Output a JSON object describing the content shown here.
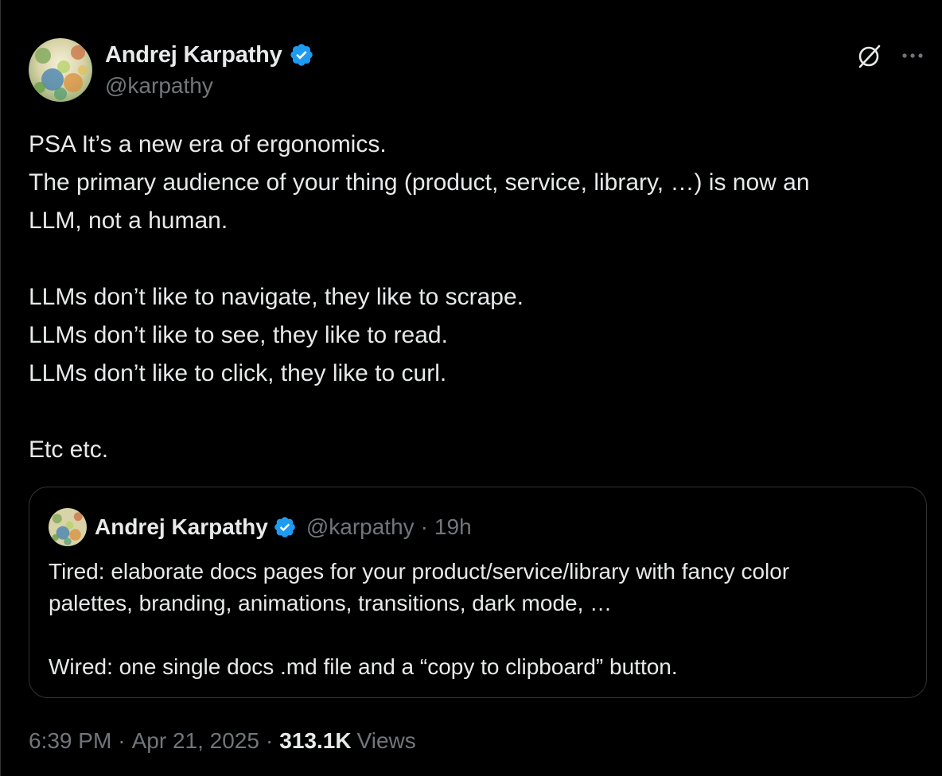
{
  "author": {
    "display_name": "Andrej Karpathy",
    "handle": "@karpathy",
    "verified": true,
    "verified_color": "#1d9bf0"
  },
  "header_actions": {
    "grok_icon": "grok-icon",
    "more_icon": "more-dots-icon"
  },
  "tweet": {
    "lines": [
      "PSA It’s a new era of ergonomics.",
      "The primary audience of your thing (product, service, library, …) is now an",
      "LLM, not a human.",
      "",
      "LLMs don’t like to navigate, they like to scrape.",
      "LLMs don’t like to see, they like to read.",
      "LLMs don’t like to click, they like to curl.",
      "",
      "Etc etc."
    ]
  },
  "quote": {
    "display_name": "Andrej Karpathy",
    "handle": "@karpathy",
    "separator": "·",
    "time": "19h",
    "lines": [
      "Tired: elaborate docs pages for your product/service/library with fancy color",
      "palettes, branding, animations, transitions, dark mode, …",
      "",
      "Wired: one single docs .md file and a “copy to clipboard” button."
    ]
  },
  "meta": {
    "time": "6:39 PM",
    "separator": "·",
    "date": "Apr 21, 2025",
    "views_count": "313.1K",
    "views_label": "Views"
  },
  "colors": {
    "background": "#000000",
    "text_primary": "#e7e9ea",
    "text_secondary": "#71767b",
    "border": "#2f3336"
  }
}
